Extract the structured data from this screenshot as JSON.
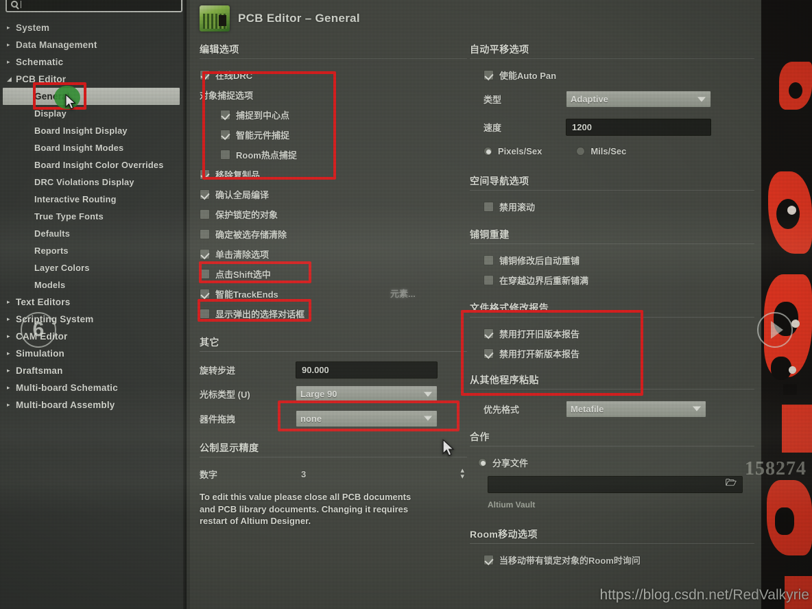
{
  "search": {
    "value": "",
    "placeholder": "",
    "icon": "search-icon"
  },
  "sidebar": {
    "items": [
      {
        "label": "System",
        "level": 1,
        "arrow": "▸",
        "selected": false
      },
      {
        "label": "Data Management",
        "level": 1,
        "arrow": "▸",
        "selected": false
      },
      {
        "label": "Schematic",
        "level": 1,
        "arrow": "▸",
        "selected": false
      },
      {
        "label": "PCB Editor",
        "level": 1,
        "arrow": "◢",
        "selected": false
      },
      {
        "label": "General",
        "level": 2,
        "arrow": "",
        "selected": true
      },
      {
        "label": "Display",
        "level": 2,
        "arrow": "",
        "selected": false
      },
      {
        "label": "Board Insight Display",
        "level": 2,
        "arrow": "",
        "selected": false
      },
      {
        "label": "Board Insight Modes",
        "level": 2,
        "arrow": "",
        "selected": false
      },
      {
        "label": "Board Insight Color Overrides",
        "level": 2,
        "arrow": "",
        "selected": false
      },
      {
        "label": "DRC Violations Display",
        "level": 2,
        "arrow": "",
        "selected": false
      },
      {
        "label": "Interactive Routing",
        "level": 2,
        "arrow": "",
        "selected": false
      },
      {
        "label": "True Type Fonts",
        "level": 2,
        "arrow": "",
        "selected": false
      },
      {
        "label": "Defaults",
        "level": 2,
        "arrow": "",
        "selected": false
      },
      {
        "label": "Reports",
        "level": 2,
        "arrow": "",
        "selected": false
      },
      {
        "label": "Layer Colors",
        "level": 2,
        "arrow": "",
        "selected": false
      },
      {
        "label": "Models",
        "level": 2,
        "arrow": "",
        "selected": false
      },
      {
        "label": "Text Editors",
        "level": 1,
        "arrow": "▸",
        "selected": false
      },
      {
        "label": "Scripting System",
        "level": 1,
        "arrow": "▸",
        "selected": false
      },
      {
        "label": "CAM Editor",
        "level": 1,
        "arrow": "▸",
        "selected": false
      },
      {
        "label": "Simulation",
        "level": 1,
        "arrow": "▸",
        "selected": false
      },
      {
        "label": "Draftsman",
        "level": 1,
        "arrow": "▸",
        "selected": false
      },
      {
        "label": "Multi-board Schematic",
        "level": 1,
        "arrow": "▸",
        "selected": false
      },
      {
        "label": "Multi-board Assembly",
        "level": 1,
        "arrow": "▸",
        "selected": false
      }
    ]
  },
  "header": {
    "title": "PCB Editor – General",
    "icon": "pcb-board-icon"
  },
  "left_column": {
    "editing_options": {
      "title": "编辑选项",
      "online_drc": {
        "label": "在线DRC",
        "checked": true
      },
      "snap_group_title": "对象捕捉选项",
      "snap_center": {
        "label": "捕捉到中心点",
        "checked": true
      },
      "smart_component_snap": {
        "label": "智能元件捕捉",
        "checked": true
      },
      "room_hotspot_snap": {
        "label": "Room热点捕捉",
        "checked": false
      },
      "remove_duplicates": {
        "label": "移除复制品",
        "checked": true
      },
      "confirm_global_edit": {
        "label": "确认全局编译",
        "checked": true
      },
      "protect_locked": {
        "label": "保护锁定的对象",
        "checked": false
      },
      "confirm_selection_clear": {
        "label": "确定被选存储清除",
        "checked": false
      },
      "click_clears_selection": {
        "label": "单击清除选项",
        "checked": true
      },
      "shift_click_to_select": {
        "label": "点击Shift选中",
        "checked": false
      },
      "smart_track_ends": {
        "label": "智能TrackEnds",
        "checked": true
      },
      "display_popup_select_dialog": {
        "label": "显示弹出的选择对话框",
        "checked": false
      },
      "primitives_button": "元素..."
    },
    "other": {
      "title": "其它",
      "rotation_step": {
        "label": "旋转步进",
        "value": "90.000"
      },
      "cursor_type": {
        "label": "光标类型 (U)",
        "value": "Large 90"
      },
      "comp_drag": {
        "label": "器件拖拽",
        "value": "none"
      }
    },
    "metric_display": {
      "title": "公制显示精度",
      "digits": {
        "label": "数字",
        "value": "3"
      },
      "help": "To edit this value please close all PCB documents and PCB library documents. Changing it requires restart of Altium Designer."
    }
  },
  "right_column": {
    "auto_pan": {
      "title": "自动平移选项",
      "enable": {
        "label": "使能Auto Pan",
        "checked": true
      },
      "type": {
        "label": "类型",
        "value": "Adaptive"
      },
      "speed": {
        "label": "速度",
        "value": "1200"
      },
      "unit_pixels": {
        "label": "Pixels/Sex",
        "selected": true
      },
      "unit_mils": {
        "label": "Mils/Sec",
        "selected": false
      }
    },
    "space_navigator": {
      "title": "空间导航选项",
      "disable_rolling": {
        "label": "禁用滚动",
        "checked": false
      }
    },
    "polygon_rebuild": {
      "title": "铺铜重建",
      "repour_after_edit": {
        "label": "铺铜修改后自动重铺",
        "checked": false
      },
      "repour_after_move": {
        "label": "在穿越边界后重新铺满",
        "checked": false
      }
    },
    "file_format_report": {
      "title": "文件格式修改报告",
      "disable_old_version": {
        "label": "禁用打开旧版本报告",
        "checked": true
      },
      "disable_new_version": {
        "label": "禁用打开新版本报告",
        "checked": true
      }
    },
    "paste_from_other": {
      "title": "从其他程序粘贴",
      "preferred_format": {
        "label": "优先格式",
        "value": "Metafile"
      }
    },
    "collaboration": {
      "title": "合作",
      "share_files": {
        "label": "分享文件",
        "selected": true
      },
      "path": {
        "value": "",
        "browse_icon": "folder-browse-icon"
      },
      "vault_note": "Altium Vault"
    },
    "room_move": {
      "title": "Room移动选项",
      "ask_when_moving_locked": {
        "label": "当移动带有锁定对象的Room时询问",
        "checked": true
      }
    }
  },
  "annotations": {
    "highlight_color": "#ef1b1b",
    "green_marker_color": "#3aa03a",
    "step_badge": "6",
    "next_arrow_icon": "chevron-right-icon"
  },
  "watermarks": {
    "number": "158274",
    "url": "https://blog.csdn.net/RedValkyrie",
    "corner": "alkyrie"
  }
}
